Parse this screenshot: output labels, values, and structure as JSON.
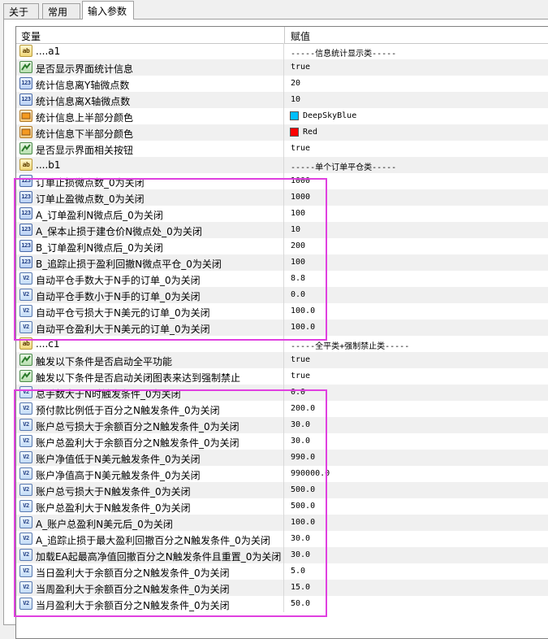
{
  "tabs": [
    {
      "label": "关于",
      "active": false
    },
    {
      "label": "常用",
      "active": false
    },
    {
      "label": "输入参数",
      "active": true
    }
  ],
  "table": {
    "col_variable": "变量",
    "col_value": "赋值"
  },
  "rows": [
    {
      "icon": "string-icon",
      "label": "....a1",
      "value": "-----信息统计显示类-----"
    },
    {
      "icon": "bool-icon",
      "label": "是否显示界面统计信息",
      "value": "true"
    },
    {
      "icon": "int-icon",
      "label": "统计信息离Y轴微点数",
      "value": "20"
    },
    {
      "icon": "int-icon",
      "label": "统计信息离X轴微点数",
      "value": "10"
    },
    {
      "icon": "color-icon",
      "label": "统计信息上半部分颜色",
      "value": "DeepSkyBlue",
      "color": "#00bfff"
    },
    {
      "icon": "color-icon",
      "label": "统计信息下半部分颜色",
      "value": "Red",
      "color": "#ff0000"
    },
    {
      "icon": "bool-icon",
      "label": "是否显示界面相关按钮",
      "value": "true"
    },
    {
      "icon": "string-icon",
      "label": "....b1",
      "value": "-----单个订单平仓类-----"
    },
    {
      "icon": "int-icon",
      "label": "订单止损微点数_0为关闭",
      "value": "1000"
    },
    {
      "icon": "int-icon",
      "label": "订单止盈微点数_0为关闭",
      "value": "1000"
    },
    {
      "icon": "int-icon",
      "label": "A_订单盈利N微点后_0为关闭",
      "value": "100"
    },
    {
      "icon": "int-icon",
      "label": "A_保本止损于建仓价N微点处_0为关闭",
      "value": "10"
    },
    {
      "icon": "int-icon",
      "label": "B_订单盈利N微点后_0为关闭",
      "value": "200"
    },
    {
      "icon": "int-icon",
      "label": "B_追踪止损于盈利回撤N微点平仓_0为关闭",
      "value": "100"
    },
    {
      "icon": "double-icon",
      "label": "自动平仓手数大于N手的订单_0为关闭",
      "value": "8.8"
    },
    {
      "icon": "double-icon",
      "label": "自动平仓手数小于N手的订单_0为关闭",
      "value": "0.0"
    },
    {
      "icon": "double-icon",
      "label": "自动平仓亏损大于N美元的订单_0为关闭",
      "value": "100.0"
    },
    {
      "icon": "double-icon",
      "label": "自动平仓盈利大于N美元的订单_0为关闭",
      "value": "100.0"
    },
    {
      "icon": "string-icon",
      "label": "....c1",
      "value": "-----全平类+强制禁止类-----"
    },
    {
      "icon": "bool-icon",
      "label": "触发以下条件是否启动全平功能",
      "value": "true"
    },
    {
      "icon": "bool-icon",
      "label": "触发以下条件是否启动关闭图表来达到强制禁止",
      "value": "true"
    },
    {
      "icon": "double-icon",
      "label": "总手数大于N时触发条件_0为关闭",
      "value": "0.0"
    },
    {
      "icon": "double-icon",
      "label": "预付款比例低于百分之N触发条件_0为关闭",
      "value": "200.0"
    },
    {
      "icon": "double-icon",
      "label": "账户总亏损大于余额百分之N触发条件_0为关闭",
      "value": "30.0"
    },
    {
      "icon": "double-icon",
      "label": "账户总盈利大于余额百分之N触发条件_0为关闭",
      "value": "30.0"
    },
    {
      "icon": "double-icon",
      "label": "账户净值低于N美元触发条件_0为关闭",
      "value": "990.0"
    },
    {
      "icon": "double-icon",
      "label": "账户净值高于N美元触发条件_0为关闭",
      "value": "990000.0"
    },
    {
      "icon": "double-icon",
      "label": "账户总亏损大于N触发条件_0为关闭",
      "value": "500.0"
    },
    {
      "icon": "double-icon",
      "label": "账户总盈利大于N触发条件_0为关闭",
      "value": "500.0"
    },
    {
      "icon": "double-icon",
      "label": "A_账户总盈利N美元后_0为关闭",
      "value": "100.0"
    },
    {
      "icon": "double-icon",
      "label": "A_追踪止损于最大盈利回撤百分之N触发条件_0为关闭",
      "value": "30.0"
    },
    {
      "icon": "double-icon",
      "label": "加载EA起最高净值回撤百分之N触发条件且重置_0为关闭",
      "value": "30.0"
    },
    {
      "icon": "double-icon",
      "label": "当日盈利大于余额百分之N触发条件_0为关闭",
      "value": "5.0"
    },
    {
      "icon": "double-icon",
      "label": "当周盈利大于余额百分之N触发条件_0为关闭",
      "value": "15.0"
    },
    {
      "icon": "double-icon",
      "label": "当月盈利大于余额百分之N触发条件_0为关闭",
      "value": "50.0"
    }
  ],
  "highlight_color": "#e040e0"
}
